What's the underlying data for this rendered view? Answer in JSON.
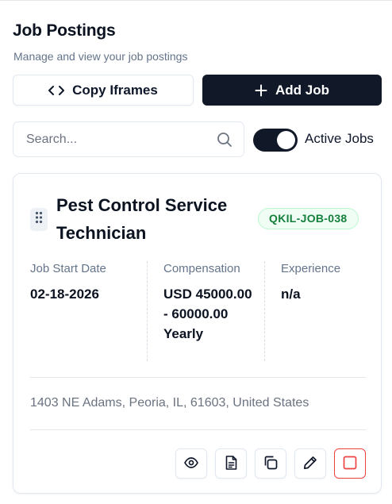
{
  "header": {
    "title": "Job Postings",
    "subtitle": "Manage and view your job postings"
  },
  "toolbar": {
    "copy_iframes_label": "Copy Iframes",
    "add_job_label": "Add Job"
  },
  "search": {
    "placeholder": "Search...",
    "value": ""
  },
  "filter": {
    "active_jobs_label": "Active Jobs",
    "active_jobs_on": true
  },
  "job": {
    "title": "Pest Control Service Technician",
    "id": "QKIL-JOB-038",
    "start_date_label": "Job Start Date",
    "start_date": "02-18-2026",
    "compensation_label": "Compensation",
    "compensation": "USD 45000.00 - 60000.00 Yearly",
    "experience_label": "Experience",
    "experience": "n/a",
    "address": "1403 NE Adams, Peoria, IL, 61603, United States"
  },
  "icons": {
    "copy_iframes": "code-icon",
    "add_job": "plus-icon",
    "search": "search-icon",
    "drag": "grip-vertical-icon",
    "view": "eye-icon",
    "details": "file-text-icon",
    "duplicate": "copy-icon",
    "edit": "pencil-icon",
    "deactivate": "square-icon"
  },
  "colors": {
    "primary": "#111827",
    "badge_text": "#15803d",
    "badge_bg": "#f0fdf4",
    "danger": "#ef4444"
  }
}
